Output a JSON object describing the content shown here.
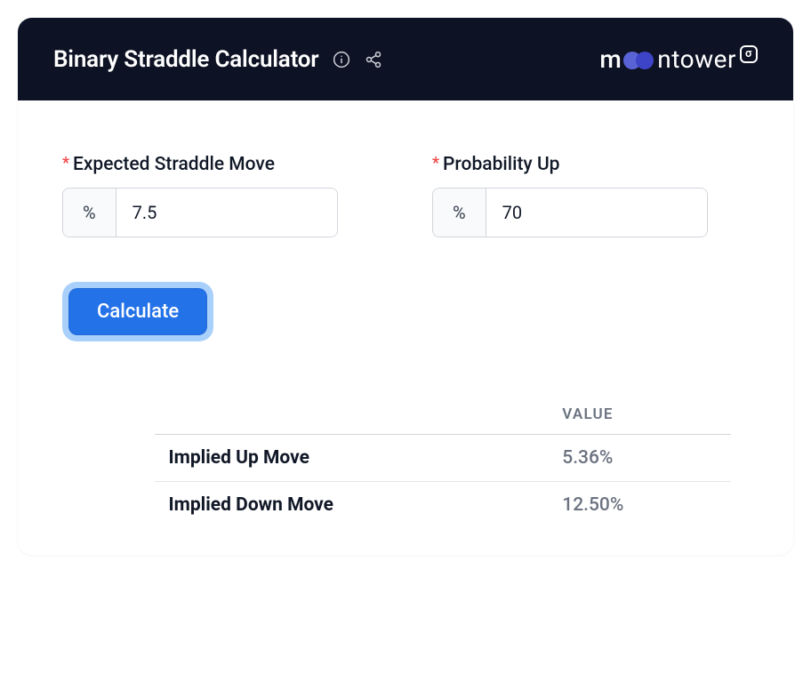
{
  "header": {
    "title": "Binary Straddle Calculator",
    "logo": {
      "prefix": "m",
      "suffix": "ntower",
      "sigma": "σ"
    }
  },
  "form": {
    "straddle": {
      "required": "*",
      "label": "Expected Straddle Move",
      "prefix": "%",
      "value": "7.5"
    },
    "probability": {
      "required": "*",
      "label": "Probability Up",
      "prefix": "%",
      "value": "70"
    },
    "calculate_label": "Calculate"
  },
  "results": {
    "value_header": "VALUE",
    "rows": [
      {
        "label": "Implied Up Move",
        "value": "5.36%"
      },
      {
        "label": "Implied Down Move",
        "value": "12.50%"
      }
    ]
  }
}
